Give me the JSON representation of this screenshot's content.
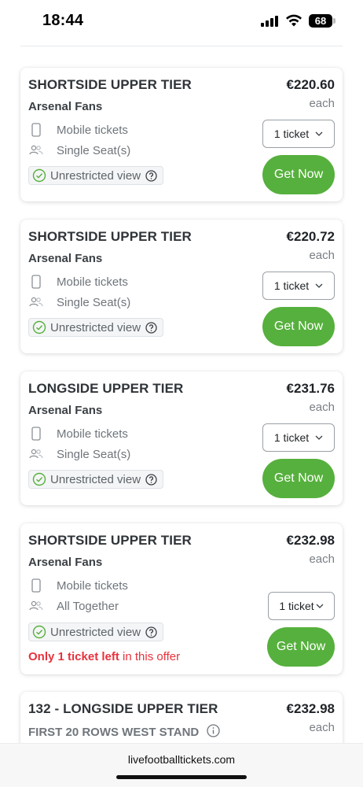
{
  "status_bar": {
    "time": "18:44",
    "battery": "68"
  },
  "listings": [
    {
      "title": "SHORTSIDE UPPER TIER",
      "subtitle": "Arsenal Fans",
      "price": "€220.60",
      "each": "each",
      "features": [
        "Mobile tickets",
        "Single Seat(s)"
      ],
      "view_badge": "Unrestricted view",
      "quantity": "1 ticket",
      "button": "Get Now"
    },
    {
      "title": "SHORTSIDE UPPER TIER",
      "subtitle": "Arsenal Fans",
      "price": "€220.72",
      "each": "each",
      "features": [
        "Mobile tickets",
        "Single Seat(s)"
      ],
      "view_badge": "Unrestricted view",
      "quantity": "1 ticket",
      "button": "Get Now"
    },
    {
      "title": "LONGSIDE UPPER TIER",
      "subtitle": "Arsenal Fans",
      "price": "€231.76",
      "each": "each",
      "features": [
        "Mobile tickets",
        "Single Seat(s)"
      ],
      "view_badge": "Unrestricted view",
      "quantity": "1 ticket",
      "button": "Get Now"
    },
    {
      "title": "SHORTSIDE UPPER TIER",
      "subtitle": "Arsenal Fans",
      "price": "€232.98",
      "each": "each",
      "features": [
        "Mobile tickets",
        "All Together"
      ],
      "view_badge": "Unrestricted view",
      "quantity": "1 ticket",
      "button": "Get Now",
      "warning_bold": "Only 1 ticket left",
      "warning_rest": " in this offer"
    },
    {
      "title": "132 - LONGSIDE UPPER TIER",
      "subtitle": "FIRST 20 ROWS WEST STAND",
      "price": "€232.98",
      "each": "each"
    }
  ],
  "url_bar": {
    "url": "livefootballtickets.com"
  },
  "colors": {
    "accent_green": "#56b03d",
    "warning_red": "#e8323c",
    "text_dark": "#2f3438"
  }
}
